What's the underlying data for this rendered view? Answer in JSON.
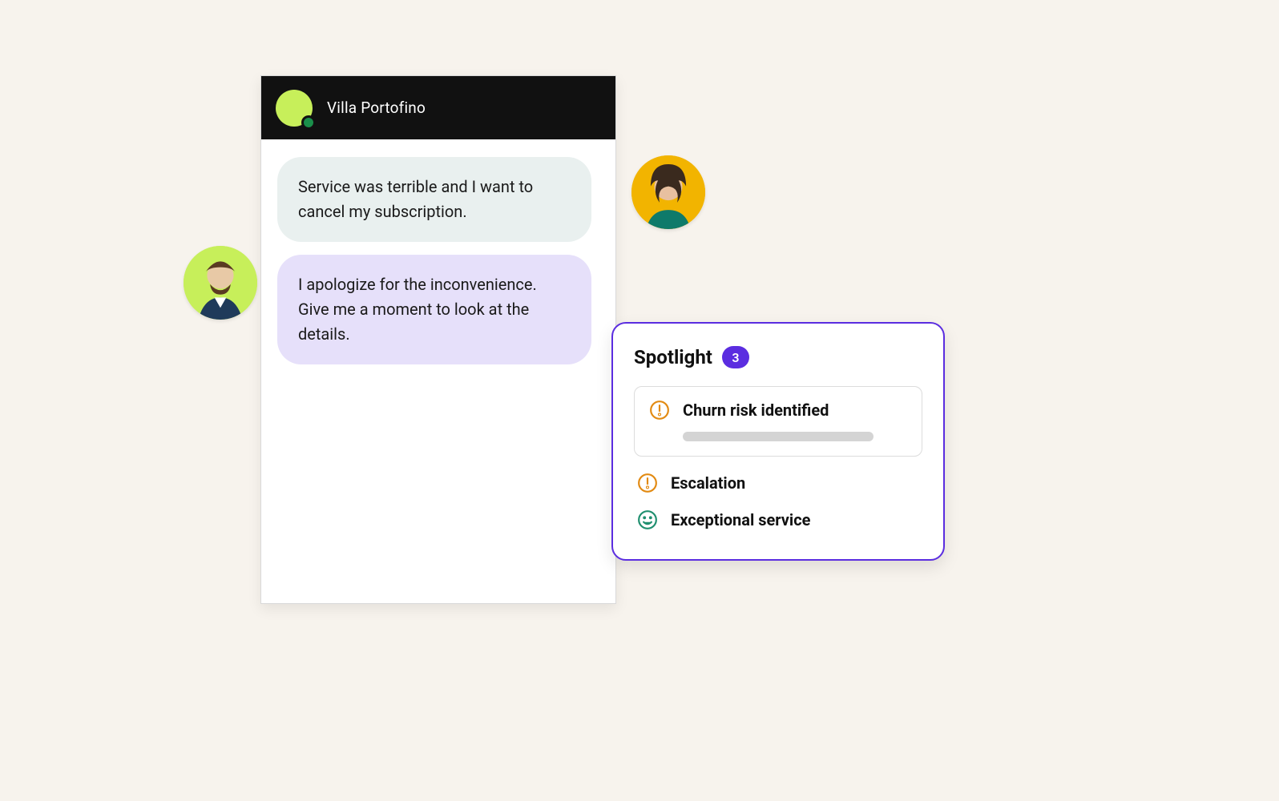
{
  "chat": {
    "title": "Villa Portofino",
    "messages": [
      {
        "role": "customer",
        "text": "Service was terrible and I want to cancel my subscription."
      },
      {
        "role": "agent",
        "text": "I apologize for the inconvenience. Give me a moment to look at the details."
      }
    ]
  },
  "avatars": {
    "agent": "agent-avatar",
    "customer": "customer-avatar"
  },
  "spotlight": {
    "title": "Spotlight",
    "count": "3",
    "items": [
      {
        "icon": "alert",
        "label": "Churn risk identified",
        "highlighted": true
      },
      {
        "icon": "alert",
        "label": "Escalation",
        "highlighted": false
      },
      {
        "icon": "smile",
        "label": "Exceptional service",
        "highlighted": false
      }
    ]
  },
  "colors": {
    "accent": "#5b2de0",
    "alert": "#e28a12",
    "positive": "#1f8f6f",
    "presence": "#1a8f4a"
  }
}
